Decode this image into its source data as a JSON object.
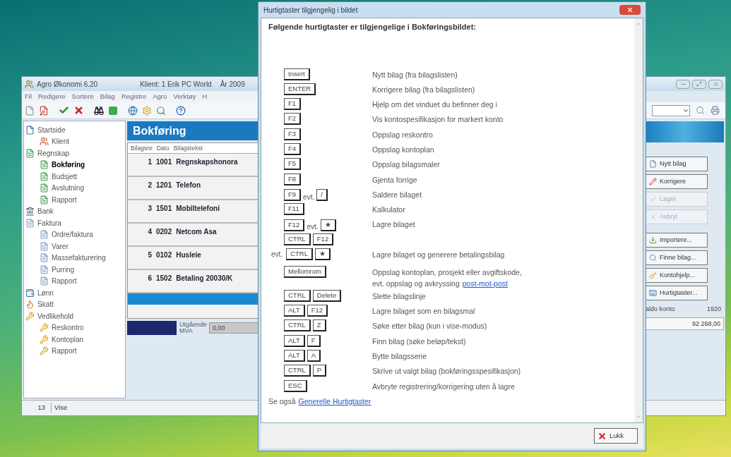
{
  "main_window": {
    "title": "Agro Økonomi 6.20",
    "client": "Klient: 1 Erik PC World",
    "year": "År 2009",
    "menu": [
      "Fil",
      "Redigere",
      "Sortere",
      "Bilag",
      "Registre",
      "Agro",
      "Verktøy",
      "H"
    ],
    "tree": [
      {
        "label": "Startside",
        "kind": "page",
        "selected": false,
        "children": [
          {
            "label": "Klient",
            "kind": "people",
            "selected": false
          }
        ]
      },
      {
        "label": "Regnskap",
        "kind": "ledger",
        "selected": false,
        "children": [
          {
            "label": "Bokføring",
            "kind": "ledger",
            "selected": true
          },
          {
            "label": "Budsjett",
            "kind": "ledger",
            "selected": false
          },
          {
            "label": "Avslutning",
            "kind": "ledger",
            "selected": false
          },
          {
            "label": "Rapport",
            "kind": "ledger",
            "selected": false
          }
        ]
      },
      {
        "label": "Bank",
        "kind": "bank",
        "selected": false
      },
      {
        "label": "Faktura",
        "kind": "invoice",
        "selected": false,
        "children": [
          {
            "label": "Ordre/faktura",
            "kind": "invoice",
            "selected": false
          },
          {
            "label": "Varer",
            "kind": "invoice",
            "selected": false
          },
          {
            "label": "Massefakturering",
            "kind": "invoice",
            "selected": false
          },
          {
            "label": "Purring",
            "kind": "invoice",
            "selected": false
          },
          {
            "label": "Rapport",
            "kind": "invoice",
            "selected": false
          }
        ]
      },
      {
        "label": "Lønn",
        "kind": "salary",
        "selected": false
      },
      {
        "label": "Skatt",
        "kind": "tax",
        "selected": false
      },
      {
        "label": "Vedlikehold",
        "kind": "tools",
        "selected": false,
        "children": [
          {
            "label": "Reskontro",
            "kind": "tools",
            "selected": false
          },
          {
            "label": "Kontoplan",
            "kind": "tools",
            "selected": false
          },
          {
            "label": "Rapport",
            "kind": "tools",
            "selected": false
          }
        ]
      }
    ],
    "panel_title": "Bokføring",
    "table": {
      "columns": [
        "Bilagsnr",
        "Dato",
        "Bilagstekst"
      ],
      "rows": [
        {
          "cells": [
            "1",
            "1001",
            "Regnskapshonora"
          ],
          "selected": false
        },
        {
          "cells": [
            "2",
            "1201",
            "Telefon"
          ],
          "selected": false
        },
        {
          "cells": [
            "3",
            "1501",
            "Mobiltelefoni"
          ],
          "selected": false
        },
        {
          "cells": [
            "4",
            "0202",
            "Netcom Asa"
          ],
          "selected": false
        },
        {
          "cells": [
            "5",
            "0102",
            "Husleie"
          ],
          "selected": false
        },
        {
          "cells": [
            "6",
            "1502",
            "Betaling 20030/K"
          ],
          "selected": false
        },
        {
          "selected": true
        }
      ]
    },
    "mva": {
      "label": "Utgående MVA",
      "value": "0,00"
    },
    "status_bar": [
      "13",
      "Vise"
    ],
    "actions": [
      {
        "label": "Nytt bilag",
        "kind": "new",
        "disabled": false
      },
      {
        "label": "Korrigere",
        "kind": "edit",
        "disabled": false
      },
      {
        "label": "Lagre",
        "kind": "save",
        "disabled": true
      },
      {
        "label": "Avbryt",
        "kind": "cancel",
        "disabled": true
      },
      {
        "label": "Importere...",
        "kind": "import",
        "disabled": false
      },
      {
        "label": "Finne bilag...",
        "kind": "find",
        "disabled": false
      },
      {
        "label": "Kontohjelp...",
        "kind": "key",
        "disabled": false
      },
      {
        "label": "Hurtigtaster...",
        "kind": "help",
        "disabled": false
      }
    ],
    "balance": {
      "label": "aldo konto",
      "account": "1920",
      "value": "92 268,00"
    }
  },
  "dialog": {
    "title": "Hurtigtaster tilgjengelig i bildet",
    "heading": "Følgende hurtigtaster er tilgjengelige i Bokføringsbildet:",
    "shortcuts": [
      {
        "groups": [
          {
            "keys": [
              "Insert"
            ]
          }
        ],
        "description": "Nytt bilag (fra bilagslisten)"
      },
      {
        "groups": [
          {
            "keys": [
              "ENTER"
            ]
          }
        ],
        "description": "Korrigere bilag (fra bilagslisten)"
      },
      {
        "groups": [
          {
            "keys": [
              "F1"
            ]
          }
        ],
        "description": "Hjelp om det vinduet du befinner deg i"
      },
      {
        "groups": [
          {
            "keys": [
              "F2"
            ]
          }
        ],
        "description": "Vis kontospesifikasjon for markert konto"
      },
      {
        "groups": [
          {
            "keys": [
              "F3"
            ]
          }
        ],
        "description": "Oppslag reskontro"
      },
      {
        "groups": [
          {
            "keys": [
              "F4"
            ]
          }
        ],
        "description": "Oppslag kontoplan"
      },
      {
        "groups": [
          {
            "keys": [
              "F5"
            ]
          }
        ],
        "description": "Oppslag bilagsmaler"
      },
      {
        "groups": [
          {
            "keys": [
              "F8"
            ]
          }
        ],
        "description": "Gjenta forrige"
      },
      {
        "groups": [
          {
            "keys": [
              "F9"
            ]
          },
          {
            "prefix": "evt.",
            "keys": [
              "/"
            ]
          }
        ],
        "description": "Saldere bilaget"
      },
      {
        "groups": [
          {
            "keys": [
              "F11"
            ]
          }
        ],
        "description": "Kalkulator"
      },
      {
        "groups": [
          {
            "keys": [
              "F12"
            ]
          },
          {
            "prefix": "evt.",
            "keys": [
              "★"
            ]
          }
        ],
        "description": "Lagre bilaget"
      },
      {
        "groups": [
          {
            "keys": [
              "CTRL",
              "F12"
            ]
          }
        ]
      },
      {
        "groups": [
          {
            "prefix": "evt.",
            "keys": [
              "CTRL",
              "★"
            ]
          }
        ],
        "description": "Lagre bilaget og generere betalingsbilag"
      },
      {
        "groups": [
          {
            "keys": [
              "Mellomrom"
            ]
          }
        ],
        "description": "Oppslag kontoplan, prosjekt eller avgiftskode,",
        "description_2": "evt. oppslag og avkryssing",
        "link": "post-mot-post"
      },
      {
        "groups": [
          {
            "keys": [
              "CTRL",
              "Delete"
            ]
          }
        ],
        "description": "Slette bilagslinje"
      },
      {
        "groups": [
          {
            "keys": [
              "ALT",
              "F12"
            ]
          }
        ],
        "description": "Lagre bilaget som en bilagsmal"
      },
      {
        "groups": [
          {
            "keys": [
              "CTRL",
              "Z"
            ]
          }
        ],
        "description": "Søke etter bilag (kun i vise-modus)"
      },
      {
        "groups": [
          {
            "keys": [
              "ALT",
              "F"
            ]
          }
        ],
        "description": "Finn bilag (søke beløp/tekst)"
      },
      {
        "groups": [
          {
            "keys": [
              "ALT",
              "A"
            ]
          }
        ],
        "description": "Bytte bilagsserie"
      },
      {
        "groups": [
          {
            "keys": [
              "CTRL",
              "P"
            ]
          }
        ],
        "description": "Skrive ut valgt bilag (bokføringsspesifikasjon)"
      },
      {
        "groups": [
          {
            "keys": [
              "ESC"
            ]
          }
        ],
        "description": "Avbryte registrering/korrigering uten å lagre"
      }
    ],
    "see_also": "Se også",
    "see_also_link": "Generelle Hurtigtaster",
    "close_button": "Lukk"
  }
}
